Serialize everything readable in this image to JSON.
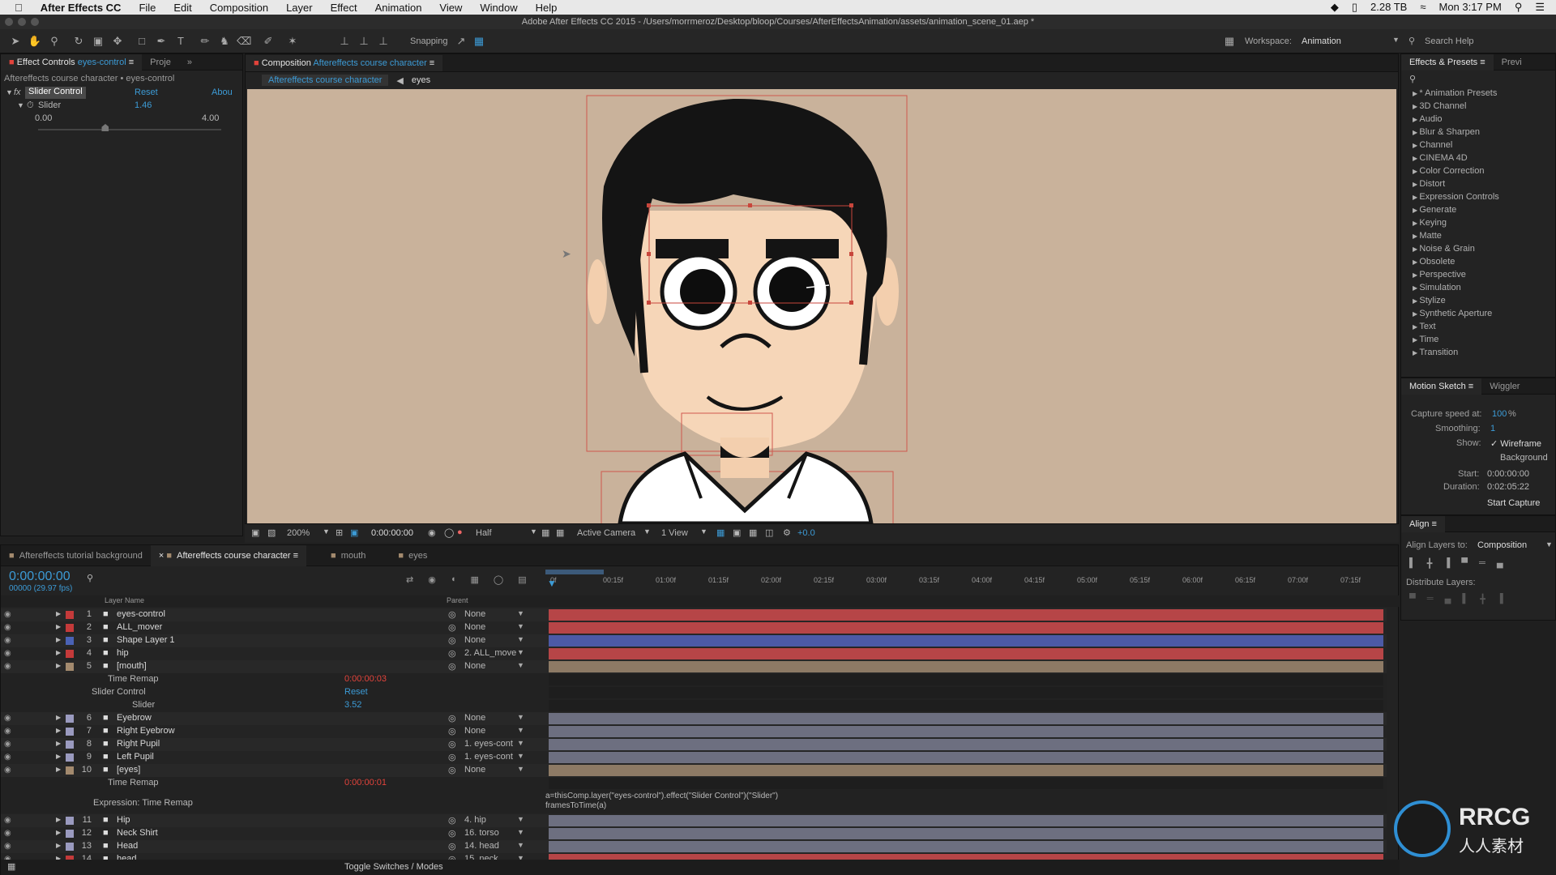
{
  "menubar": {
    "app": "After Effects CC",
    "items": [
      "File",
      "Edit",
      "Composition",
      "Layer",
      "Effect",
      "Animation",
      "View",
      "Window",
      "Help"
    ],
    "disk": "2.28 TB",
    "clock": "Mon 3:17 PM"
  },
  "window": {
    "title": "Adobe After Effects CC 2015 - /Users/morrmeroz/Desktop/bloop/Courses/AfterEffectsAnimation/assets/animation_scene_01.aep *"
  },
  "toolbar": {
    "snapping": "Snapping",
    "workspace_label": "Workspace:",
    "workspace_value": "Animation",
    "search_help": "Search Help"
  },
  "effect_controls": {
    "tab": "Effect Controls",
    "tab_layer": "eyes-control",
    "tab2": "Proje",
    "breadcrumb": "Aftereffects course character • eyes-control",
    "effect_name": "Slider Control",
    "reset": "Reset",
    "about": "Abou",
    "slider_label": "Slider",
    "slider_value": "1.46",
    "range_min": "0.00",
    "range_max": "4.00",
    "slider_fraction": 0.365
  },
  "composition": {
    "tab_prefix": "Composition",
    "tab_name": "Aftereffects course character",
    "crumb1": "Aftereffects course character",
    "crumb2": "eyes",
    "zoom": "200%",
    "timecode": "0:00:00:00",
    "resolution": "Half",
    "camera": "Active Camera",
    "views": "1 View",
    "exposure": "+0.0"
  },
  "effects_presets": {
    "tab": "Effects & Presets",
    "tab2": "Previ",
    "items": [
      "* Animation Presets",
      "3D Channel",
      "Audio",
      "Blur & Sharpen",
      "Channel",
      "CINEMA 4D",
      "Color Correction",
      "Distort",
      "Expression Controls",
      "Generate",
      "Keying",
      "Matte",
      "Noise & Grain",
      "Obsolete",
      "Perspective",
      "Simulation",
      "Stylize",
      "Synthetic Aperture",
      "Text",
      "Time",
      "Transition"
    ]
  },
  "motion_sketch": {
    "tab": "Motion Sketch",
    "tab2": "Wiggler",
    "capture_label": "Capture speed at:",
    "capture_value": "100",
    "capture_unit": "%",
    "smoothing_label": "Smoothing:",
    "smoothing_value": "1",
    "show_label": "Show:",
    "wireframe": "Wireframe",
    "background": "Background",
    "start_label": "Start:",
    "start_value": "0:00:00:00",
    "duration_label": "Duration:",
    "duration_value": "0:02:05:22",
    "button": "Start Capture"
  },
  "align": {
    "tab": "Align",
    "align_to_label": "Align Layers to:",
    "align_to_value": "Composition",
    "distribute": "Distribute Layers:"
  },
  "timeline": {
    "tabs": [
      "Aftereffects tutorial background",
      "Aftereffects course character",
      "mouth",
      "eyes"
    ],
    "timecode": "0:00:00:00",
    "fps": "00000 (29.97 fps)",
    "col_layer": "Layer Name",
    "col_parent": "Parent",
    "toggle": "Toggle Switches / Modes",
    "ticks": [
      "0f",
      "00:15f",
      "01:00f",
      "01:15f",
      "02:00f",
      "02:15f",
      "03:00f",
      "03:15f",
      "04:00f",
      "04:15f",
      "05:00f",
      "05:15f",
      "06:00f",
      "06:15f",
      "07:00f",
      "07:15f"
    ],
    "layers": [
      {
        "num": "1",
        "name": "eyes-control",
        "color": "#c43a3a",
        "parent": "None",
        "bar": "#b64547"
      },
      {
        "num": "2",
        "name": "ALL_mover",
        "color": "#c43a3a",
        "parent": "None",
        "bar": "#b64547"
      },
      {
        "num": "3",
        "name": "Shape Layer 1",
        "color": "#4a62b5",
        "parent": "None",
        "bar": "#4c5aa6"
      },
      {
        "num": "4",
        "name": "hip",
        "color": "#c43a3a",
        "parent": "2. ALL_move",
        "bar": "#b64547"
      },
      {
        "num": "5",
        "name": "[mouth]",
        "color": "#a38a6e",
        "parent": "None",
        "bar": "#8d7a65"
      }
    ],
    "sub5": {
      "time_remap": "Time Remap",
      "time_remap_val": "0:00:00:03",
      "slider_control": "Slider Control",
      "reset": "Reset",
      "slider": "Slider",
      "slider_val": "3.52"
    },
    "layers2": [
      {
        "num": "6",
        "name": "Eyebrow",
        "color": "#9a9abf",
        "parent": "None",
        "bar": "#6d6f80"
      },
      {
        "num": "7",
        "name": "Right Eyebrow",
        "color": "#9a9abf",
        "parent": "None",
        "bar": "#6d6f80"
      },
      {
        "num": "8",
        "name": "Right Pupil",
        "color": "#9a9abf",
        "parent": "1. eyes-cont",
        "bar": "#6d6f80"
      },
      {
        "num": "9",
        "name": "Left Pupil",
        "color": "#9a9abf",
        "parent": "1. eyes-cont",
        "bar": "#6d6f80"
      },
      {
        "num": "10",
        "name": "[eyes]",
        "color": "#a38a6e",
        "parent": "None",
        "bar": "#8d7a65"
      }
    ],
    "sub10": {
      "time_remap": "Time Remap",
      "time_remap_val": "0:00:00:01",
      "expression_label": "Expression: Time Remap",
      "expr_line1": "a=thisComp.layer(\"eyes-control\").effect(\"Slider Control\")(\"Slider\")",
      "expr_line2": "framesToTime(a)"
    },
    "layers3": [
      {
        "num": "11",
        "name": "Hip",
        "color": "#9a9abf",
        "parent": "4. hip",
        "bar": "#6d6f80"
      },
      {
        "num": "12",
        "name": "Neck Shirt",
        "color": "#9a9abf",
        "parent": "16. torso",
        "bar": "#6d6f80"
      },
      {
        "num": "13",
        "name": "Head",
        "color": "#9a9abf",
        "parent": "14. head",
        "bar": "#6d6f80"
      },
      {
        "num": "14",
        "name": "head",
        "color": "#c43a3a",
        "parent": "15. neck",
        "bar": "#b64547"
      }
    ]
  },
  "watermark": {
    "brand": "RRCG",
    "sub": "人人素材"
  }
}
